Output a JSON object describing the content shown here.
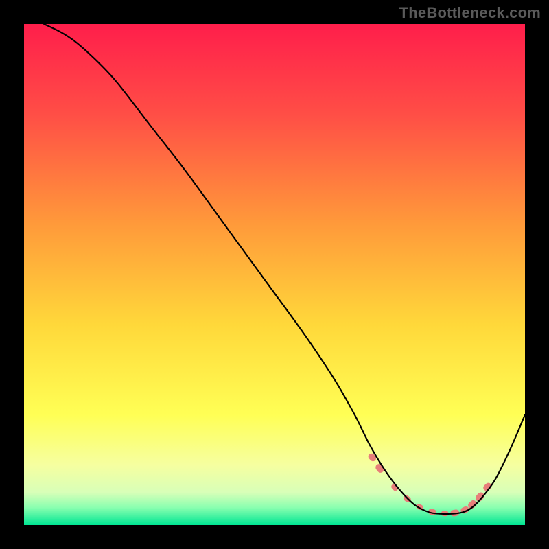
{
  "watermark": "TheBottleneck.com",
  "chart_data": {
    "type": "line",
    "title": "",
    "xlabel": "",
    "ylabel": "",
    "xlim": [
      0,
      100
    ],
    "ylim": [
      0,
      100
    ],
    "grid": false,
    "legend": false,
    "background_gradient_stops": [
      {
        "offset": 0.0,
        "color": "#ff1e4b"
      },
      {
        "offset": 0.18,
        "color": "#ff4e46"
      },
      {
        "offset": 0.4,
        "color": "#ff9a3a"
      },
      {
        "offset": 0.6,
        "color": "#ffd83a"
      },
      {
        "offset": 0.78,
        "color": "#ffff55"
      },
      {
        "offset": 0.88,
        "color": "#f6ffa0"
      },
      {
        "offset": 0.935,
        "color": "#d8ffb8"
      },
      {
        "offset": 0.965,
        "color": "#8affb0"
      },
      {
        "offset": 1.0,
        "color": "#00e693"
      }
    ],
    "series": [
      {
        "name": "curve",
        "color": "#000000",
        "stroke_width": 2.2,
        "x": [
          4,
          8,
          12,
          18,
          25,
          32,
          40,
          48,
          56,
          62,
          66,
          69,
          72,
          75,
          78,
          81,
          84,
          87,
          89,
          91,
          94,
          97,
          100
        ],
        "values": [
          100,
          98,
          95,
          89,
          80,
          71,
          60,
          49,
          38,
          29,
          22,
          16,
          11,
          7,
          4,
          2.5,
          2.2,
          2.4,
          3.2,
          5,
          9,
          15,
          22
        ]
      }
    ],
    "markers": {
      "name": "bottleneck-markers",
      "color": "#e77e7a",
      "radius_min": 3.5,
      "radius_max": 5.5,
      "x": [
        69.5,
        71,
        74,
        76.5,
        79,
        81.5,
        84,
        86,
        88,
        89.5,
        91,
        92.5
      ],
      "values": [
        13.5,
        11.3,
        7.5,
        5.2,
        3.6,
        2.6,
        2.3,
        2.4,
        3.0,
        4.1,
        5.6,
        7.6
      ],
      "radii": [
        4.8,
        5.2,
        4.2,
        4.4,
        4.0,
        4.6,
        4.2,
        5.0,
        4.8,
        5.2,
        5.4,
        5.0
      ]
    }
  }
}
